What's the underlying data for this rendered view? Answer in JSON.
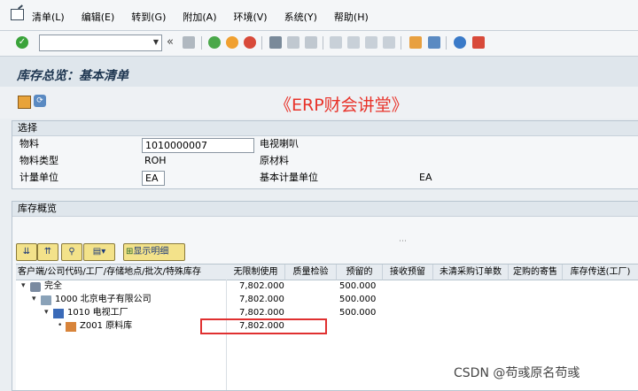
{
  "menu": [
    "清单(L)",
    "编辑(E)",
    "转到(G)",
    "附加(A)",
    "环境(V)",
    "系统(Y)",
    "帮助(H)"
  ],
  "toolbar": {
    "command_value": "",
    "collapse_glyph": "«"
  },
  "title": "库存总览：基本清单",
  "watermark_top": "《ERP财会讲堂》",
  "selection": {
    "header": "选择",
    "material_label": "物料",
    "material_value": "1010000007",
    "material_desc": "电视喇叭",
    "type_label": "物料类型",
    "type_value": "ROH",
    "type_desc": "原材料",
    "unit_label": "计量单位",
    "unit_value": "EA",
    "base_unit_label": "基本计量单位",
    "base_unit_value": "EA"
  },
  "overview": {
    "header": "库存概览",
    "show_detail_label": "显示明细",
    "columns": [
      "客户端/公司代码/工厂/存储地点/批次/特殊库存",
      "无限制使用",
      "质量检验",
      "预留的",
      "接收预留",
      "未清采购订单数",
      "定购的寄售",
      "库存传送(工厂)"
    ],
    "rows": [
      {
        "label": "完全",
        "unrestricted": "7,802.000",
        "reserved": "500.000"
      },
      {
        "label": "1000 北京电子有限公司",
        "unrestricted": "7,802.000",
        "reserved": "500.000"
      },
      {
        "label": "1010 电视工厂",
        "unrestricted": "7,802.000",
        "reserved": "500.000"
      },
      {
        "label": "Z001 原料库",
        "unrestricted": "7,802.000",
        "reserved": ""
      }
    ]
  },
  "watermark_bottom": "CSDN @苟彧原名苟彧",
  "colors": {
    "highlight": "#e03030",
    "watermark": "#e8332a",
    "title": "#1d3550"
  }
}
